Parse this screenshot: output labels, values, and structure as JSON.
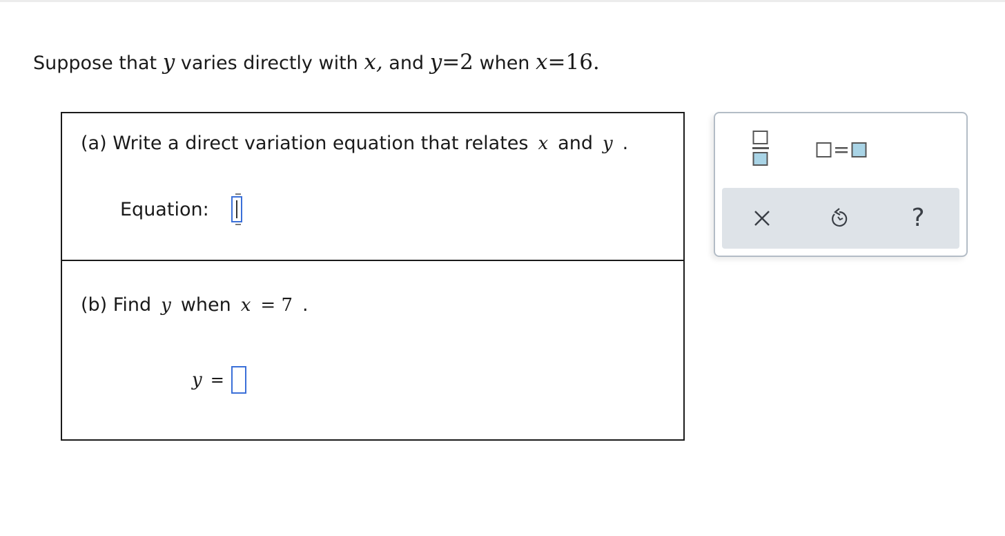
{
  "problem": {
    "t1": "Suppose that",
    "v1": "y",
    "t2": "varies directly with",
    "v2": "x,",
    "t3": "and",
    "v3": "y",
    "eq1": "=2",
    "t4": "when",
    "v4": "x",
    "eq2": "=16."
  },
  "part_a": {
    "prompt": "(a) Write a direct variation equation that relates",
    "var1": "x",
    "conj": "and",
    "var2": "y",
    "period": ".",
    "answer_label": "Equation:",
    "answer_value": ""
  },
  "part_b": {
    "prompt_start": "(b) Find",
    "var1": "y",
    "prompt_mid": "when",
    "var2": "x",
    "eq": "= 7",
    "period": ".",
    "answer_var": "y",
    "answer_eq": "=",
    "answer_value": ""
  },
  "toolbox": {
    "tools": [
      "fraction-icon",
      "equation-template-icon"
    ],
    "actions": {
      "clear_icon": "close-icon",
      "undo_icon": "undo-icon",
      "help_label": "?"
    }
  },
  "colors": {
    "slot_border": "#3a6fd8",
    "tool_fill": "#a9d4e6",
    "toolbar_bg": "#dee3e8"
  }
}
